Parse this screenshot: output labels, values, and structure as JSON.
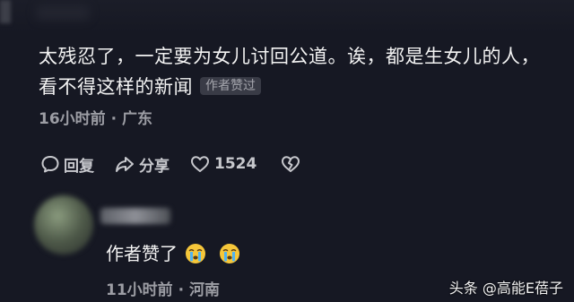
{
  "comment": {
    "text": "太残忍了，一定要为女儿讨回公道。诶，都是生女儿的人，看不得这样的新闻",
    "author_liked_badge": "作者赞过",
    "time": "16小时前",
    "separator": "·",
    "location": "广东"
  },
  "actions": {
    "reply_label": "回复",
    "share_label": "分享",
    "like_count": "1524"
  },
  "reply": {
    "text": "作者赞了",
    "emojis": [
      "crying-emoji",
      "crying-emoji"
    ],
    "time": "11小时前",
    "separator": "·",
    "location": "河南"
  },
  "watermark": {
    "text": "头条 @高能E蓓子"
  },
  "colors": {
    "background": "#161823",
    "text": "#f2f2f2",
    "meta": "#9c9da4",
    "badge_bg": "#393b46"
  }
}
